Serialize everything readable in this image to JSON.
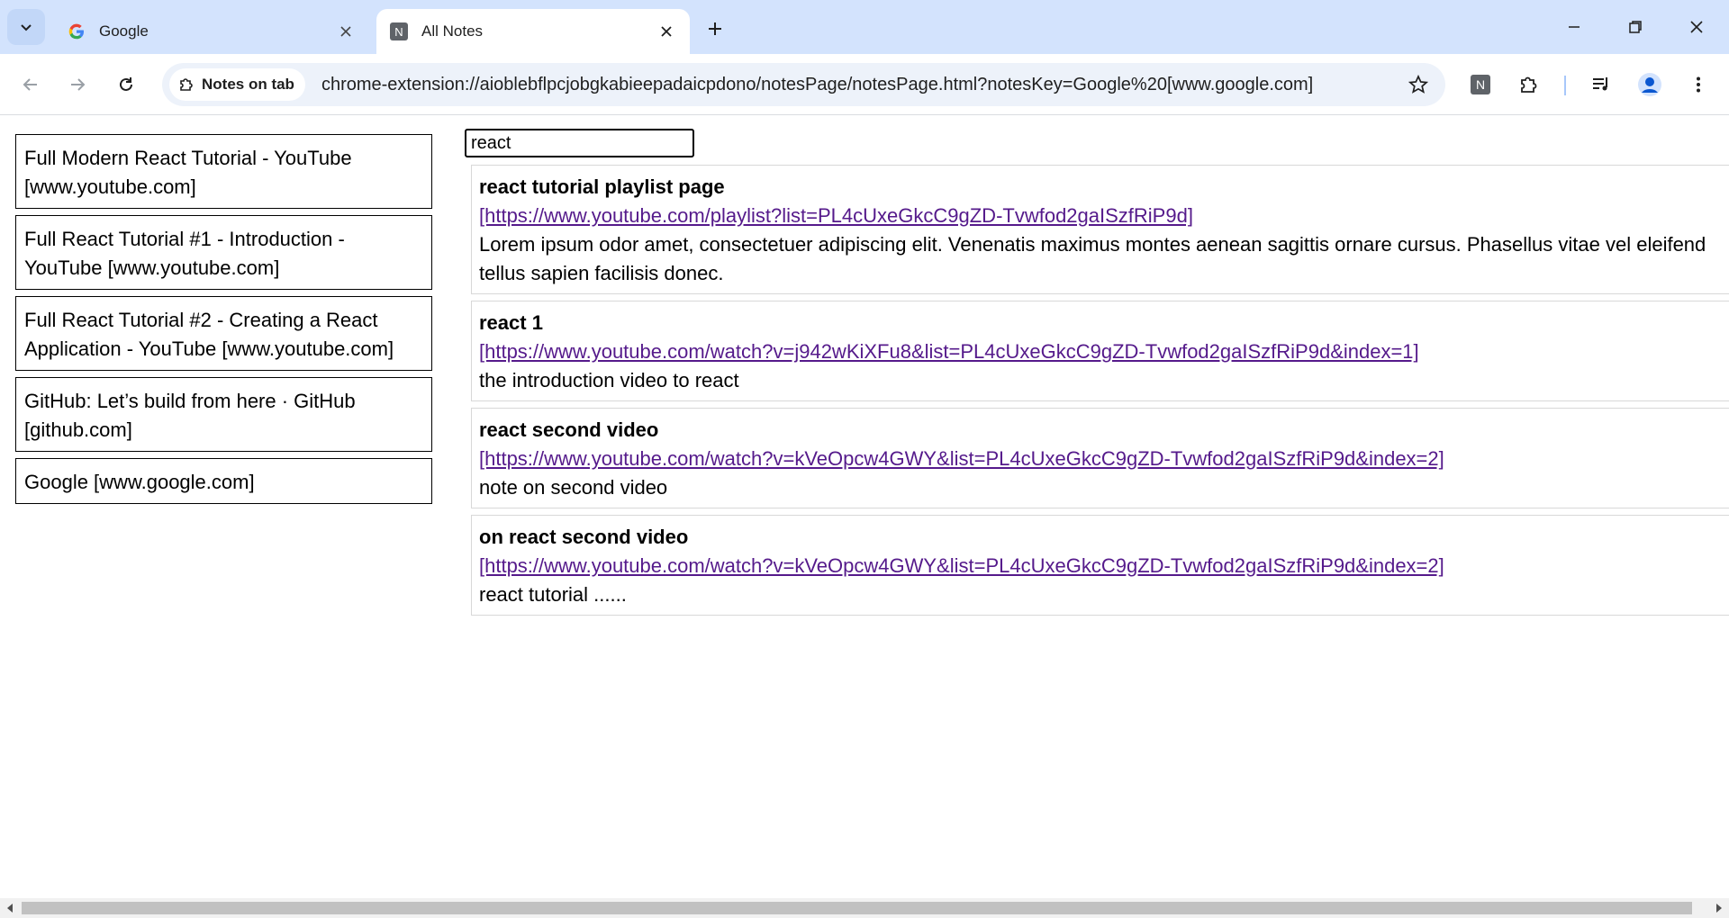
{
  "browser": {
    "tabs": [
      {
        "title": "Google",
        "icon": "google-favicon",
        "active": false
      },
      {
        "title": "All Notes",
        "icon": "notes-favicon",
        "active": true
      }
    ],
    "omnibox": {
      "chip_label": "Notes on tab",
      "url": "chrome-extension://aioblebflpcjobgkabieepadaicpdono/notesPage/notesPage.html?notesKey=Google%20[www.google.com]"
    },
    "notes_ext_letter": "N",
    "accent_color": "#0b57d0"
  },
  "sidebar": {
    "items": [
      {
        "label": "Full Modern React Tutorial - YouTube [www.youtube.com]"
      },
      {
        "label": "Full React Tutorial #1 - Introduction - YouTube [www.youtube.com]"
      },
      {
        "label": "Full React Tutorial #2 - Creating a React Application - YouTube [www.youtube.com]"
      },
      {
        "label": "GitHub: Let’s build from here · GitHub [github.com]"
      },
      {
        "label": "Google [www.google.com]"
      }
    ]
  },
  "search": {
    "value": "react"
  },
  "notes": [
    {
      "title": "react tutorial playlist page",
      "link": "[https://www.youtube.com/playlist?list=PL4cUxeGkcC9gZD-Tvwfod2gaISzfRiP9d]",
      "body": "Lorem ipsum odor amet, consectetuer adipiscing elit. Venenatis maximus montes aenean sagittis ornare cursus. Phasellus vitae vel eleifend tellus sapien facilisis donec."
    },
    {
      "title": "react 1",
      "link": "[https://www.youtube.com/watch?v=j942wKiXFu8&list=PL4cUxeGkcC9gZD-Tvwfod2gaISzfRiP9d&index=1]",
      "body": "the introduction video to react"
    },
    {
      "title": "react second video",
      "link": "[https://www.youtube.com/watch?v=kVeOpcw4GWY&list=PL4cUxeGkcC9gZD-Tvwfod2gaISzfRiP9d&index=2]",
      "body": "note on second video"
    },
    {
      "title": "on react second video",
      "link": "[https://www.youtube.com/watch?v=kVeOpcw4GWY&list=PL4cUxeGkcC9gZD-Tvwfod2gaISzfRiP9d&index=2]",
      "body": "react tutorial ......"
    }
  ]
}
